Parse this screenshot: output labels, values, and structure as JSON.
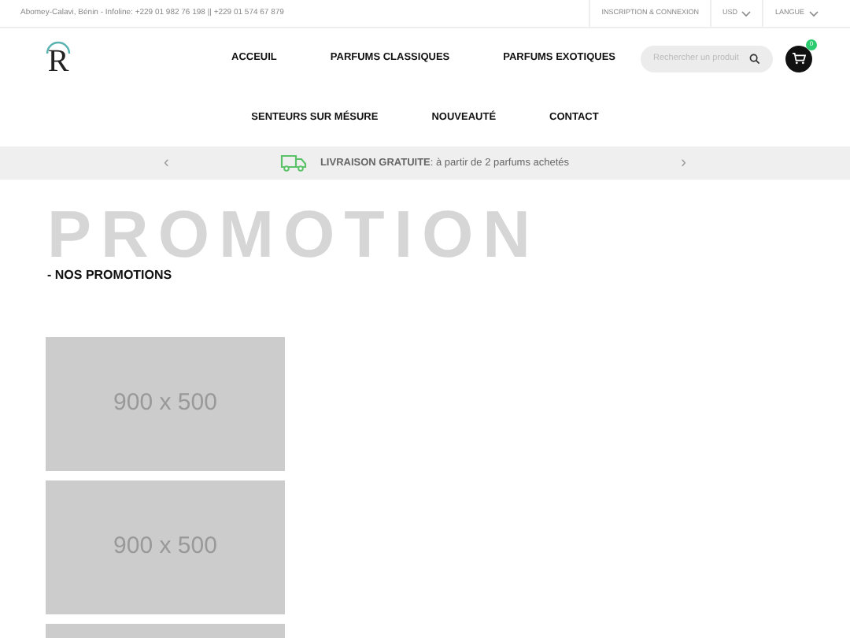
{
  "top_bar": {
    "contact": "Abomey-Calavi, Bénin - Infoline: +229 01 982 76 198 || +229 01 574 67 879",
    "links": [
      {
        "label": "INSCRIPTION & CONNEXION",
        "kind": "link"
      },
      {
        "label": "USD",
        "kind": "dropdown"
      },
      {
        "label": "LANGUE",
        "kind": "dropdown"
      }
    ]
  },
  "logo": {
    "text": "R"
  },
  "nav": {
    "row_1": [
      "ACCEUIL",
      "PARFUMS CLASSIQUES",
      "PARFUMS EXOTIQUES"
    ],
    "row_2": [
      "SENTEURS SUR MÉSURE",
      "NOUVEAUTÉ",
      "CONTACT"
    ]
  },
  "search": {
    "placeholder": "Rechercher un produit"
  },
  "cart": {
    "count": "0"
  },
  "banner": {
    "prev": "‹",
    "next": "›",
    "text": "**LIVRAISON GRATUITE**: à partir de 2 parfums achetés"
  },
  "section": {
    "backdrop": "PROMOTION",
    "title": "- NOS PROMOTIONS"
  },
  "promotions": [
    {
      "kind": "placeholder",
      "label": "900 x 500"
    },
    {
      "kind": "placeholder",
      "label": "900 x 500"
    },
    {
      "kind": "picture"
    }
  ]
}
